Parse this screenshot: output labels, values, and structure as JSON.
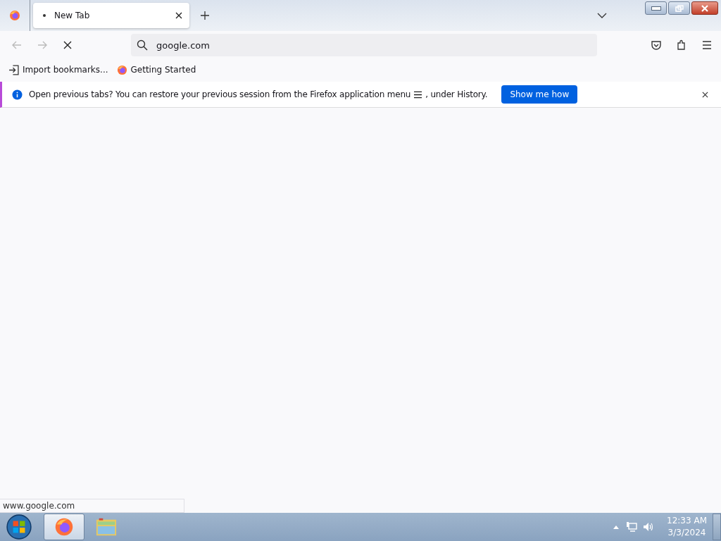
{
  "tabs": [
    {
      "title": "New Tab",
      "selected": true,
      "loading": true
    }
  ],
  "address_bar": {
    "value": "google.com"
  },
  "navigation": {
    "back_disabled": true,
    "forward_disabled": true
  },
  "bookmarks": [
    {
      "label": "Import bookmarks...",
      "kind": "import"
    },
    {
      "label": "Getting Started",
      "kind": "firefox"
    }
  ],
  "notification": {
    "message": "Open previous tabs? You can restore your previous session from the Firefox application menu",
    "message_end": ", under History.",
    "button": "Show me how"
  },
  "status_text": "www.google.com",
  "taskbar": {
    "apps": [
      {
        "kind": "firefox",
        "selected": true
      },
      {
        "kind": "explorer",
        "selected": false
      }
    ],
    "time": "12:33 AM",
    "date": "3/3/2024"
  }
}
